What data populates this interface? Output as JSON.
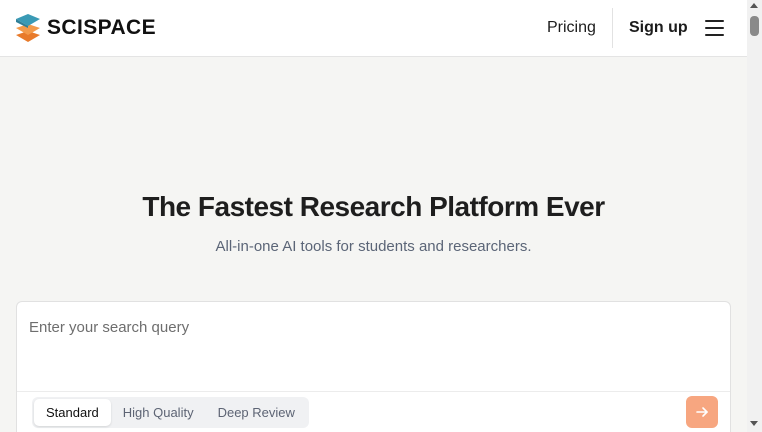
{
  "header": {
    "brand": "SCISPACE",
    "nav": {
      "pricing_label": "Pricing",
      "signup_label": "Sign up"
    },
    "icons": {
      "logo": "scispace-logo-icon",
      "menu": "hamburger-menu-icon"
    }
  },
  "hero": {
    "title": "The Fastest Research Platform Ever",
    "subtitle": "All-in-one AI tools for students and researchers."
  },
  "search": {
    "placeholder": "Enter your search query",
    "value": "",
    "modes": [
      "Standard",
      "High Quality",
      "Deep Review"
    ],
    "selected_mode": "Standard",
    "submit_icon": "arrow-right-icon"
  },
  "colors": {
    "accent": "#f7a680",
    "logo_teal": "#3a9ab5",
    "logo_orange": "#f08c3a",
    "background": "#f5f5f3",
    "subtitle_text": "#5b6577"
  }
}
